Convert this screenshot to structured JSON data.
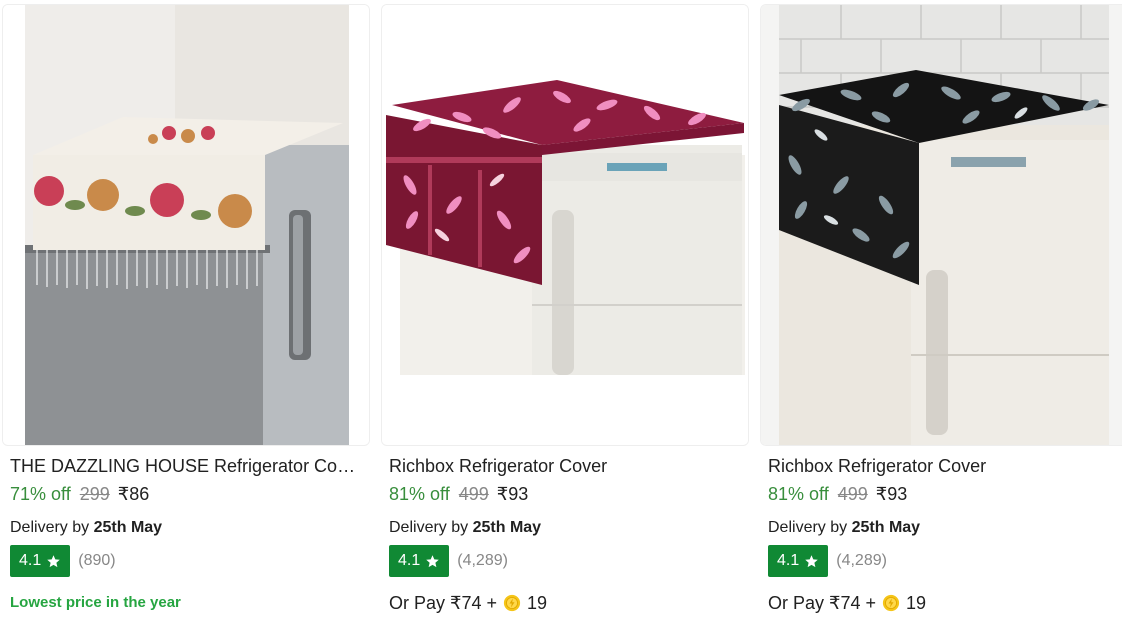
{
  "products": [
    {
      "title": "THE DAZZLING HOUSE Refrigerator Cover",
      "discount": "71% off",
      "mrp": "299",
      "price": "₹86",
      "delivery_prefix": "Delivery by",
      "delivery_date": "25th May",
      "rating": "4.1",
      "reviews": "(890)",
      "promo": "Lowest price in the year",
      "image_icon": "fridge-with-lace-cover"
    },
    {
      "title": "Richbox Refrigerator Cover",
      "discount": "81% off",
      "mrp": "499",
      "price": "₹93",
      "delivery_prefix": "Delivery by",
      "delivery_date": "25th May",
      "rating": "4.1",
      "reviews": "(4,289)",
      "orpay_prefix": "Or Pay ₹74 +",
      "orpay_coins": "19",
      "image_icon": "fridge-with-maroon-leaf-cover"
    },
    {
      "title": "Richbox Refrigerator Cover",
      "discount": "81% off",
      "mrp": "499",
      "price": "₹93",
      "delivery_prefix": "Delivery by",
      "delivery_date": "25th May",
      "rating": "4.1",
      "reviews": "(4,289)",
      "orpay_prefix": "Or Pay ₹74 +",
      "orpay_coins": "19",
      "image_icon": "fridge-with-black-leaf-cover"
    }
  ],
  "colors": {
    "discount_green": "#388e3c",
    "rating_badge": "#108934",
    "promo_green": "#26a541",
    "muted_gray": "#878787",
    "coin_yellow": "#f5c518"
  }
}
